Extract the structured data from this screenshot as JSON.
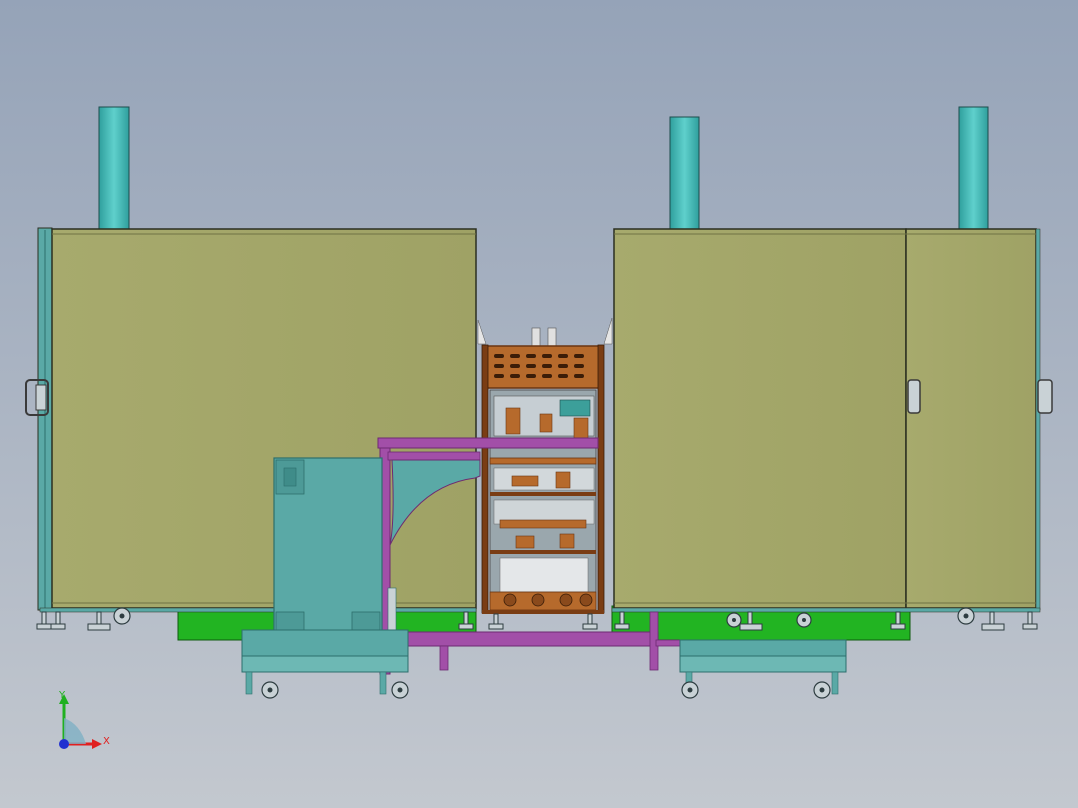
{
  "viewport": {
    "background_top": "#95a3b8",
    "background_bottom": "#c3c8cf"
  },
  "colors": {
    "panel": "#a4a76a",
    "panel_edge": "#2b2f20",
    "teal": "#5aa9a6",
    "teal_dark": "#2c6e6c",
    "column": "#3fb8b6",
    "base_green": "#22b422",
    "frame_magenta": "#a24fa8",
    "frame_magenta_dark": "#6d2a72",
    "copper": "#b66a2c",
    "copper_dark": "#6a3512",
    "steel": "#c9d2d6",
    "axis_x": "#e02020",
    "axis_y": "#20b020",
    "axis_z": "#2030d0"
  },
  "triad": {
    "x_label": "X",
    "y_label": "Y"
  }
}
